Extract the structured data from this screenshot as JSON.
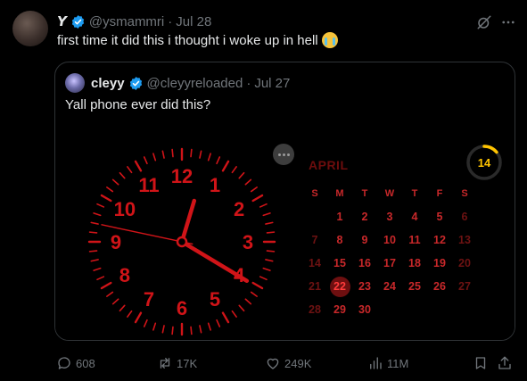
{
  "tweet": {
    "display_name": "ꓬ",
    "handle": "@ysmammri",
    "date": "Jul 28",
    "text": "first time it did this i thought i woke up in hell",
    "emoji": "crying-face"
  },
  "quote": {
    "display_name": "cleyy",
    "handle": "@cleyyreloaded",
    "date": "Jul 27",
    "text": "Yall phone ever did this?"
  },
  "clock": {
    "numbers": [
      "12",
      "1",
      "2",
      "3",
      "4",
      "5",
      "6",
      "7",
      "8",
      "9",
      "10",
      "11"
    ],
    "hour": 4,
    "minute": 2,
    "second": 47,
    "color": "#d01418"
  },
  "calendar": {
    "month": "APRIL",
    "weekdays": [
      "S",
      "M",
      "T",
      "W",
      "T",
      "F",
      "S"
    ],
    "weeks": [
      [
        "",
        "1",
        "2",
        "3",
        "4",
        "5",
        "6"
      ],
      [
        "7",
        "8",
        "9",
        "10",
        "11",
        "12",
        "13"
      ],
      [
        "14",
        "15",
        "16",
        "17",
        "18",
        "19",
        "20"
      ],
      [
        "21",
        "22",
        "23",
        "24",
        "25",
        "26",
        "27"
      ],
      [
        "28",
        "29",
        "30",
        "",
        "",
        "",
        ""
      ]
    ],
    "today": "22",
    "color": "#c8282a"
  },
  "battery_ring": {
    "label": "14",
    "percent": 14,
    "color": "#ffc400"
  },
  "actions": {
    "replies": "608",
    "reposts": "17K",
    "likes": "249K",
    "views": "11M"
  },
  "colors": {
    "background": "#000000",
    "text": "#e7e9ea",
    "muted": "#71767b",
    "verified": "#1d9bf0",
    "border": "#2f3336"
  }
}
